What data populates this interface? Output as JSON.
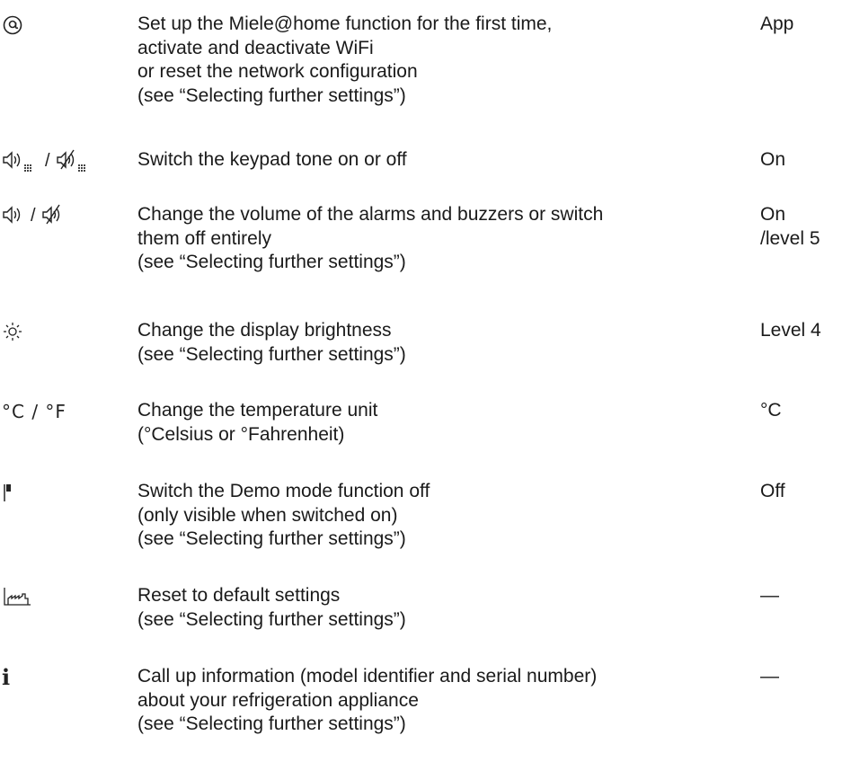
{
  "rows": [
    {
      "icon": "at-symbol-icon",
      "desc": [
        "Set up the Miele@home function for the first time,",
        "activate and deactivate WiFi",
        "or reset the network configuration",
        "(see “Selecting further settings”)"
      ],
      "value": [
        "App"
      ]
    },
    {
      "icon": "keypad-tone-icon",
      "sep": "/",
      "desc": [
        "Switch the keypad tone on or off"
      ],
      "value": [
        "On"
      ]
    },
    {
      "icon": "volume-icon",
      "sep": "/",
      "desc": [
        "Change the volume of the alarms and buzzers or switch",
        "them off entirely",
        "(see “Selecting further settings”)"
      ],
      "value": [
        "On",
        "/level 5"
      ]
    },
    {
      "icon": "brightness-icon",
      "desc": [
        "Change the display brightness",
        "(see “Selecting further settings”)"
      ],
      "value": [
        "Level 4"
      ]
    },
    {
      "icon": "temperature-unit-icon",
      "symbol_text": "°C / °F",
      "desc": [
        "Change the temperature unit",
        "(°Celsius or °Fahrenheit)"
      ],
      "value": [
        "°C"
      ]
    },
    {
      "icon": "demo-flag-icon",
      "desc": [
        "Switch the Demo mode function off",
        "(only visible when switched on)",
        "(see “Selecting further settings”)"
      ],
      "value": [
        "Off"
      ]
    },
    {
      "icon": "factory-reset-icon",
      "desc": [
        "Reset to default settings",
        "(see “Selecting further settings”)"
      ],
      "value": [
        "—"
      ]
    },
    {
      "icon": "info-icon",
      "symbol_text": "i",
      "desc": [
        "Call up information (model identifier and serial number)",
        "about your refrigeration appliance",
        "(see “Selecting further settings”)"
      ],
      "value": [
        "—"
      ]
    }
  ]
}
